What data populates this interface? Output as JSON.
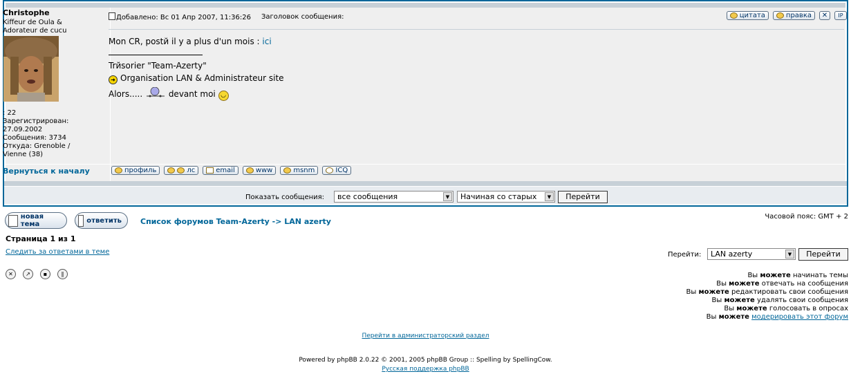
{
  "post": {
    "author": "Christophe",
    "rank_lines": [
      "Kiffeur de Oula &",
      "Adorateur de cucu"
    ],
    "details": [
      ": 22",
      "Зарегистрирован:",
      "27.09.2002",
      "Сообщения: 3734",
      "Откуда: Grenoble /",
      "Vienne (38)"
    ],
    "posted_label": "Добавлено: Вс 01 Апр 2007, 11:36:26",
    "subject_label": "Заголовок сообщения:",
    "body_text_1": "Mon CR, postй il y a plus d'un mois : ",
    "body_link": "ici",
    "sig_line1": "Trйsorier \"Team-Azerty\"",
    "sig_line2": "Organisation LAN & Administrateur site",
    "sig_line3_a": "Alors.....",
    "sig_line3_b": "devant moi",
    "back_to_top": "Вернуться к началу"
  },
  "top_buttons": [
    "цитата",
    "правка"
  ],
  "bottom_buttons": [
    "профиль",
    "лс",
    "email",
    "www",
    "msnm",
    "ICQ"
  ],
  "display_bar": {
    "label": "Показать сообщения:",
    "filter_value": "все сообщения",
    "order_value": "Начиная со старых",
    "go_label": "Перейти"
  },
  "footer": {
    "new_topic": "новая тема",
    "reply": "ответить",
    "nav_forum": "Список форумов Team-Azerty",
    "nav_sep": "->",
    "nav_topic": "LAN azerty",
    "timezone": "Часовой пояс: GMT + 2",
    "page_info": "Страница 1 из 1",
    "watch_link": "Следить за ответами в теме",
    "jump_label": "Перейти:",
    "jump_value": "LAN azerty",
    "jump_go": "Перейти",
    "permissions": [
      {
        "pre": "Вы",
        "strong": "можете",
        "post": "начинать темы",
        "link": ""
      },
      {
        "pre": "Вы",
        "strong": "можете",
        "post": "отвечать на сообщения",
        "link": ""
      },
      {
        "pre": "Вы",
        "strong": "можете",
        "post": "редактировать свои сообщения",
        "link": ""
      },
      {
        "pre": "Вы",
        "strong": "можете",
        "post": "удалять свои сообщения",
        "link": ""
      },
      {
        "pre": "Вы",
        "strong": "можете",
        "post": "голосовать в опросах",
        "link": ""
      },
      {
        "pre": "Вы",
        "strong": "можете",
        "post": "",
        "link": "модерировать этот форум"
      }
    ],
    "admin_link": "Перейти в администраторский раздел",
    "powered": "Powered by phpBB 2.0.22 © 2001, 2005 phpBB Group :: Spelling by SpellingCow.",
    "ru_support": "Русская поддержка phpBB"
  }
}
